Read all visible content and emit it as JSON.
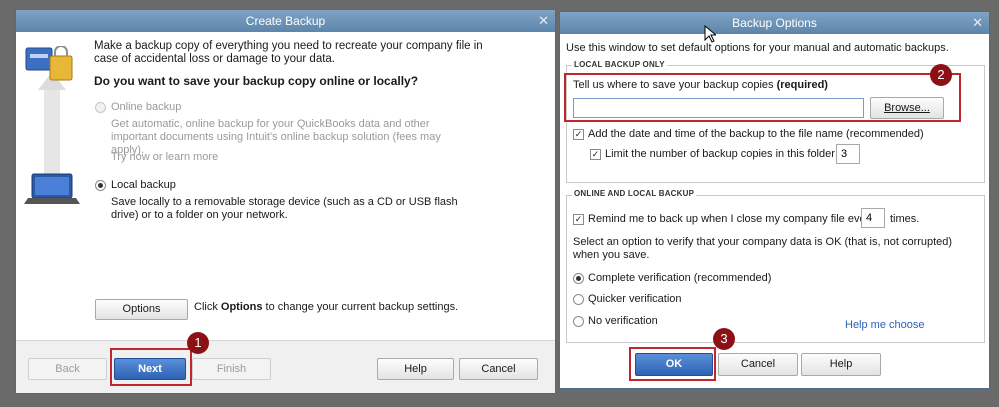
{
  "create_backup": {
    "title": "Create Backup",
    "intro": "Make a backup copy of everything you need to recreate your company file in case of accidental loss or damage to your data.",
    "question": "Do you want to save your backup copy online or locally?",
    "online_label": "Online backup",
    "online_desc": "Get automatic, online backup for your QuickBooks data and other important documents using Intuit's online backup solution (fees may apply).",
    "try_now": "Try now or learn more",
    "local_label": "Local backup",
    "local_desc": "Save locally to a removable storage device (such as a CD or USB flash drive) or to a folder on your network.",
    "options_button": "Options",
    "options_hint_pre": "Click ",
    "options_hint_bold": "Options",
    "options_hint_post": " to change your current backup settings.",
    "back_button": "Back",
    "next_button": "Next",
    "finish_button": "Finish",
    "help_button": "Help",
    "cancel_button": "Cancel"
  },
  "backup_options": {
    "title": "Backup Options",
    "intro": "Use this window to set default options for your manual and automatic backups.",
    "local_group": "LOCAL BACKUP ONLY",
    "location_label": "Tell us where to save your backup copies ",
    "location_required": "(required)",
    "location_value": "",
    "browse_button": "Browse...",
    "add_date_label": "Add the date and time of the backup to the file name (recommended)",
    "limit_label": "Limit the number of backup copies in this folder to",
    "limit_value": "3",
    "online_local_group": "ONLINE AND LOCAL BACKUP",
    "remind_label": "Remind me to back up when I close my company file every",
    "remind_value": "4",
    "remind_suffix": "times.",
    "verify_prompt": "Select an option to verify that your company data is OK (that is, not corrupted) when you save.",
    "complete_label": "Complete verification (recommended)",
    "quicker_label": "Quicker verification",
    "none_label": "No verification",
    "help_me_choose": "Help me choose",
    "ok_button": "OK",
    "cancel_button": "Cancel",
    "help_button": "Help"
  },
  "badges": [
    "1",
    "2",
    "3"
  ],
  "colors": {
    "annotation_red": "#c0262d",
    "badge_fill": "#8b1116",
    "titlebar": "#6f95b9",
    "link": "#2a62b8"
  }
}
